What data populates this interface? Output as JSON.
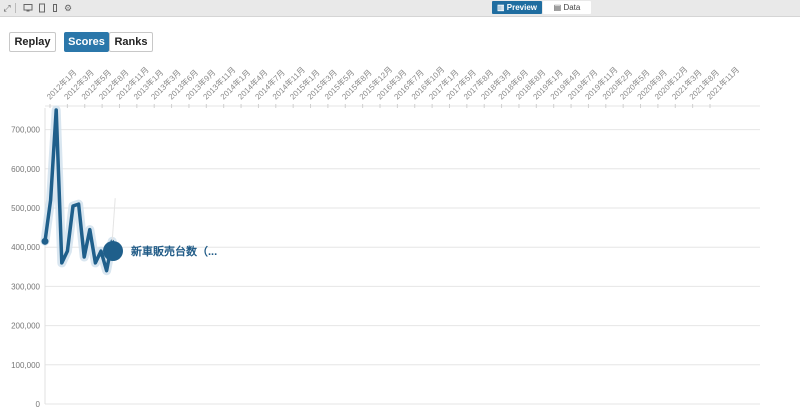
{
  "toolbar": {
    "preview_label": "Preview",
    "data_label": "Data",
    "icons": [
      "expand-icon",
      "desktop-icon",
      "tablet-icon",
      "phone-icon",
      "gear-icon"
    ]
  },
  "controls": {
    "replay_label": "Replay",
    "scores_label": "Scores",
    "ranks_label": "Ranks",
    "active": "Scores"
  },
  "chart_data": {
    "type": "line",
    "title": "",
    "xlabel": "",
    "ylabel": "",
    "ylim": [
      0,
      750000
    ],
    "y_ticks": [
      0,
      100000,
      200000,
      300000,
      400000,
      500000,
      600000,
      700000
    ],
    "y_tick_labels": [
      "0",
      "100,000",
      "200,000",
      "300,000",
      "400,000",
      "500,000",
      "600,000",
      "700,000"
    ],
    "x_tick_labels": [
      "2012年1月",
      "2012年3月",
      "2012年5月",
      "2012年8月",
      "2012年11月",
      "2013年1月",
      "2013年3月",
      "2013年6月",
      "2013年9月",
      "2013年11月",
      "2014年1月",
      "2014年4月",
      "2014年7月",
      "2014年11月",
      "2015年1月",
      "2015年3月",
      "2015年5月",
      "2015年8月",
      "2015年12月",
      "2016年3月",
      "2016年7月",
      "2016年10月",
      "2017年1月",
      "2017年5月",
      "2017年8月",
      "2018年3月",
      "2018年6月",
      "2018年8月",
      "2019年1月",
      "2019年4月",
      "2019年7月",
      "2019年11月",
      "2020年2月",
      "2020年5月",
      "2020年9月",
      "2020年12月",
      "2021年3月",
      "2021年8月",
      "2021年11月"
    ],
    "series": [
      {
        "name": "新車販売台数（...",
        "color": "#1f5f8b",
        "values": [
          415000,
          520000,
          750000,
          360000,
          390000,
          505000,
          510000,
          375000,
          445000,
          360000,
          390000,
          340000,
          415000
        ]
      }
    ],
    "grid": true
  }
}
